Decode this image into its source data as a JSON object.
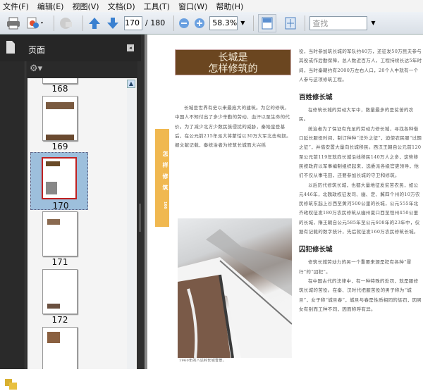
{
  "menu": [
    "文件(F)",
    "编辑(E)",
    "视图(V)",
    "文档(D)",
    "工具(T)",
    "窗口(W)",
    "帮助(H)"
  ],
  "toolbar": {
    "page_current": "170",
    "page_total": "/ 180",
    "zoom": "58.3%",
    "search_placeholder": "查找"
  },
  "sidebar": {
    "title": "页面",
    "thumbnails": [
      {
        "label": "168"
      },
      {
        "label": "169"
      },
      {
        "label": "170",
        "selected": true
      },
      {
        "label": "171"
      },
      {
        "label": "172"
      }
    ]
  },
  "doc": {
    "title_line1": "长城是",
    "title_line2": "怎样修筑的",
    "side_tab": "怎样修筑",
    "side_num": "166",
    "left_para": "长城是世界有史以来最庞大的建筑。为它的修筑，中国人不知付出了多少辛勤的劳动、血汗以至生命的代价。为了减少北方少数民族侵扰的威胁，秦始皇登基后，在公元前215年派大将蒙恬以30万大军北击匈奴。据文献记载，秦统治者为修筑长城而大兴徭",
    "right_intro": "役，当时参加筑长城的军队约40万，还征发50万民夫参与其役或作后勤保障，总人数近百万人，工程持续长达5年时间，当时秦朝约有2000万左右人口，20个人中就有一个人参与这项修筑工程。",
    "h1": "百姓修长城",
    "p1": "在修筑长城的劳动大军中，数量最多的是贫苦的农民。",
    "p2": "统治者为了保证有充足的劳动力修长城，寻找各种借口延长服役时间，制订种种“法外之征”，迫使农民服“过期之征”，并借安置大量向长城移民。西汉王朝自公元前120至公元前119年就向长城沿线移民140万人之多，这些移民按政府以军事编制组织起来，选委派各级官吏领导，他们不仅从事屯田，还要参加长城的守卫和修筑。",
    "p3": "以后历代修筑长城，也都大量地征发贫苦农民，如公元446年，北魏政权征发司、幽、定、冀四个州的10万农民修筑东起上谷西至黄河500公里的长城，公元555年北齐政权征发180万农民修筑从幽州夏口西至恒州450公里的长城，隋王朝自公元585年至公元608年的23年中，仅据有记载的数字统计，先后就征发160万农民修筑长城。",
    "h2": "囚犯修长城",
    "p4": "修筑长城劳动力的另一个重要来源是犯有各种“罪行”的“囚犯”。",
    "p5": "在中国古代的法律中，有一种特殊的处罚，就是服修筑长城的苦役。在秦、汉时代把服苦役的男子称为“城旦”，女子称“城旦春”，城旦与春是性质相同的惩罚，因男女有别而工种不同，因而称呼有异。",
    "caption": "1960年的八达岭长城雪景。"
  }
}
